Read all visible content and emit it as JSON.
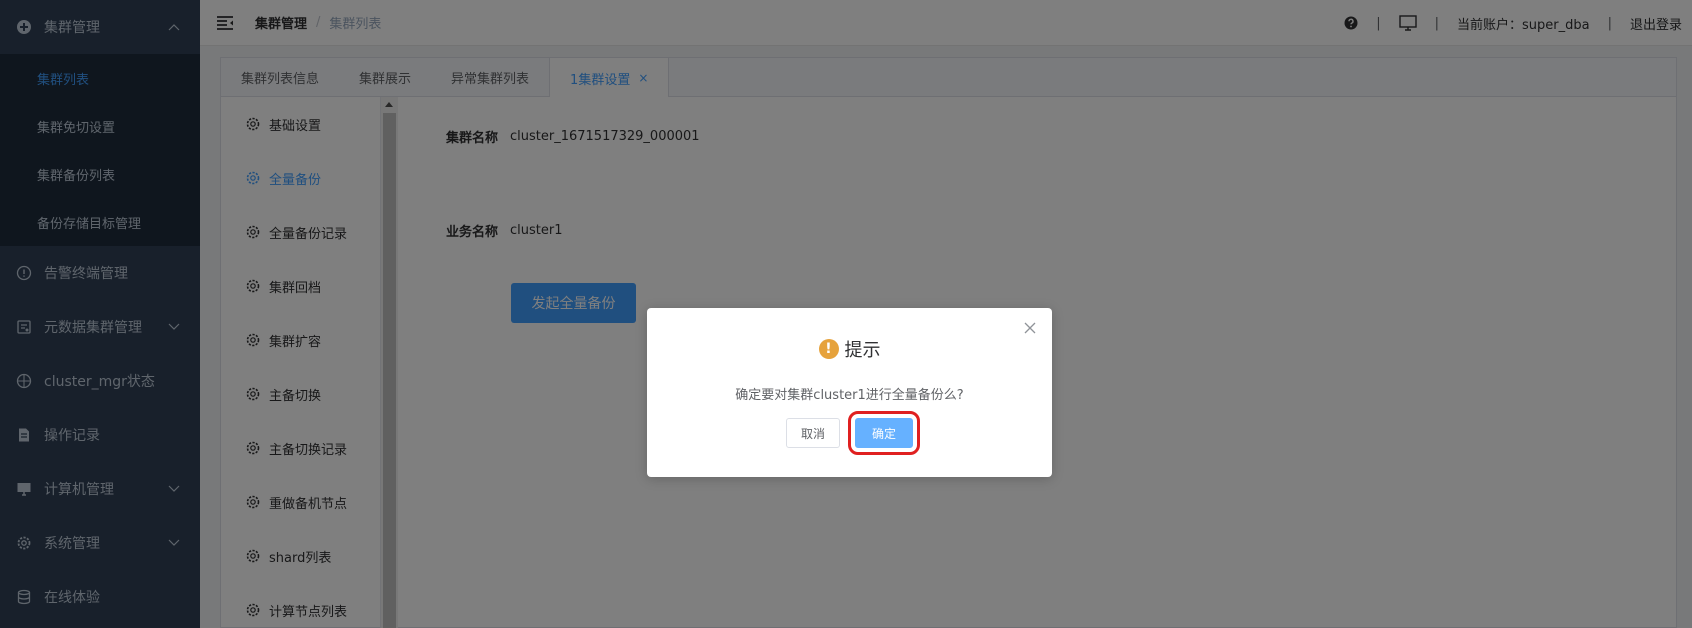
{
  "sidebar": {
    "groups": [
      {
        "label": "集群管理",
        "icon": "cluster-icon",
        "expanded": true
      },
      {
        "label": "告警终端管理",
        "icon": "alert-icon"
      },
      {
        "label": "元数据集群管理",
        "icon": "metadata-icon"
      },
      {
        "label": "cluster_mgr状态",
        "icon": "status-icon"
      },
      {
        "label": "操作记录",
        "icon": "log-icon"
      },
      {
        "label": "计算机管理",
        "icon": "computer-icon"
      },
      {
        "label": "系统管理",
        "icon": "gear-icon"
      },
      {
        "label": "在线体验",
        "icon": "database-icon"
      }
    ],
    "sub_items": [
      "集群列表",
      "集群免切设置",
      "集群备份列表",
      "备份存储目标管理"
    ]
  },
  "header": {
    "breadcrumb_root": "集群管理",
    "breadcrumb_sep": "/",
    "breadcrumb_current": "集群列表",
    "sep": "|",
    "account": "当前账户：super_dba",
    "logout": "退出登录"
  },
  "tabs": [
    {
      "label": "集群列表信息"
    },
    {
      "label": "集群展示"
    },
    {
      "label": "异常集群列表"
    },
    {
      "label": "1集群设置",
      "active": true,
      "close": "×"
    }
  ],
  "side_list": [
    "基础设置",
    "全量备份",
    "全量备份记录",
    "集群回档",
    "集群扩容",
    "主备切换",
    "主备切换记录",
    "重做备机节点",
    "shard列表",
    "计算节点列表"
  ],
  "form": {
    "cluster_name_label": "集群名称",
    "cluster_name_value": "cluster_1671517329_000001",
    "business_name_label": "业务名称",
    "business_name_value": "cluster1",
    "start_backup_button": "发起全量备份"
  },
  "dialog": {
    "icon_glyph": "!",
    "title": "提示",
    "message": "确定要对集群cluster1进行全量备份么?",
    "cancel": "取消",
    "confirm": "确定"
  },
  "colors": {
    "sidebar_bg": "#304156",
    "accent": "#409eff",
    "warning": "#e6a23c",
    "highlight": "#e02020"
  }
}
